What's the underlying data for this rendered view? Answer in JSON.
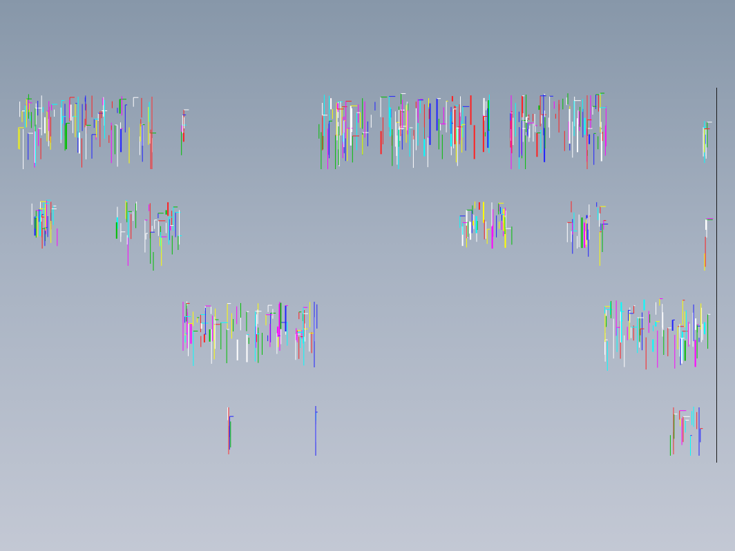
{
  "viewport": {
    "background_top": "#8797a9",
    "background_bottom": "#c3c8d4"
  },
  "drawing": {
    "description_colors": [
      "#ffffff",
      "#ff2020",
      "#ff00ff",
      "#2020ff",
      "#00ffff",
      "#ffff00",
      "#00c000",
      "#ffffff"
    ],
    "frame_border_color": "#1a1a1a"
  }
}
